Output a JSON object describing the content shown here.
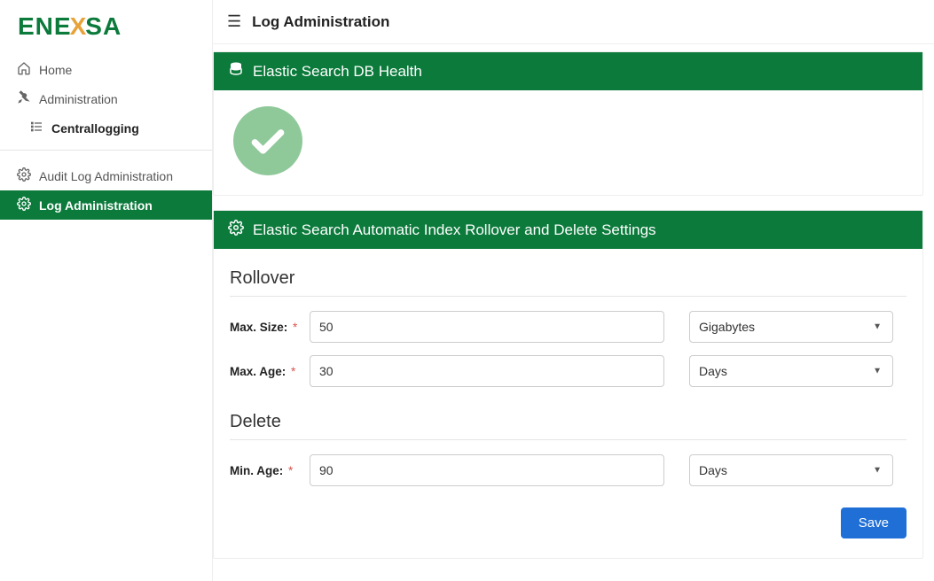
{
  "brand": {
    "pre": "ENE",
    "mid": "X",
    "post": "SA"
  },
  "sidebar": {
    "items": [
      {
        "label": "Home"
      },
      {
        "label": "Administration"
      },
      {
        "label": "Centrallogging"
      }
    ],
    "sub": [
      {
        "label": "Audit Log Administration"
      },
      {
        "label": "Log Administration"
      }
    ]
  },
  "page": {
    "title": "Log Administration"
  },
  "card_health": {
    "title": "Elastic Search DB Health"
  },
  "card_settings": {
    "title": "Elastic Search Automatic Index Rollover and Delete Settings",
    "rollover": {
      "heading": "Rollover",
      "max_size_label": "Max. Size:",
      "max_size_value": "50",
      "max_size_unit": "Gigabytes",
      "max_age_label": "Max. Age:",
      "max_age_value": "30",
      "max_age_unit": "Days"
    },
    "delete": {
      "heading": "Delete",
      "min_age_label": "Min. Age:",
      "min_age_value": "90",
      "min_age_unit": "Days"
    },
    "save_label": "Save"
  },
  "required_marker": "*"
}
